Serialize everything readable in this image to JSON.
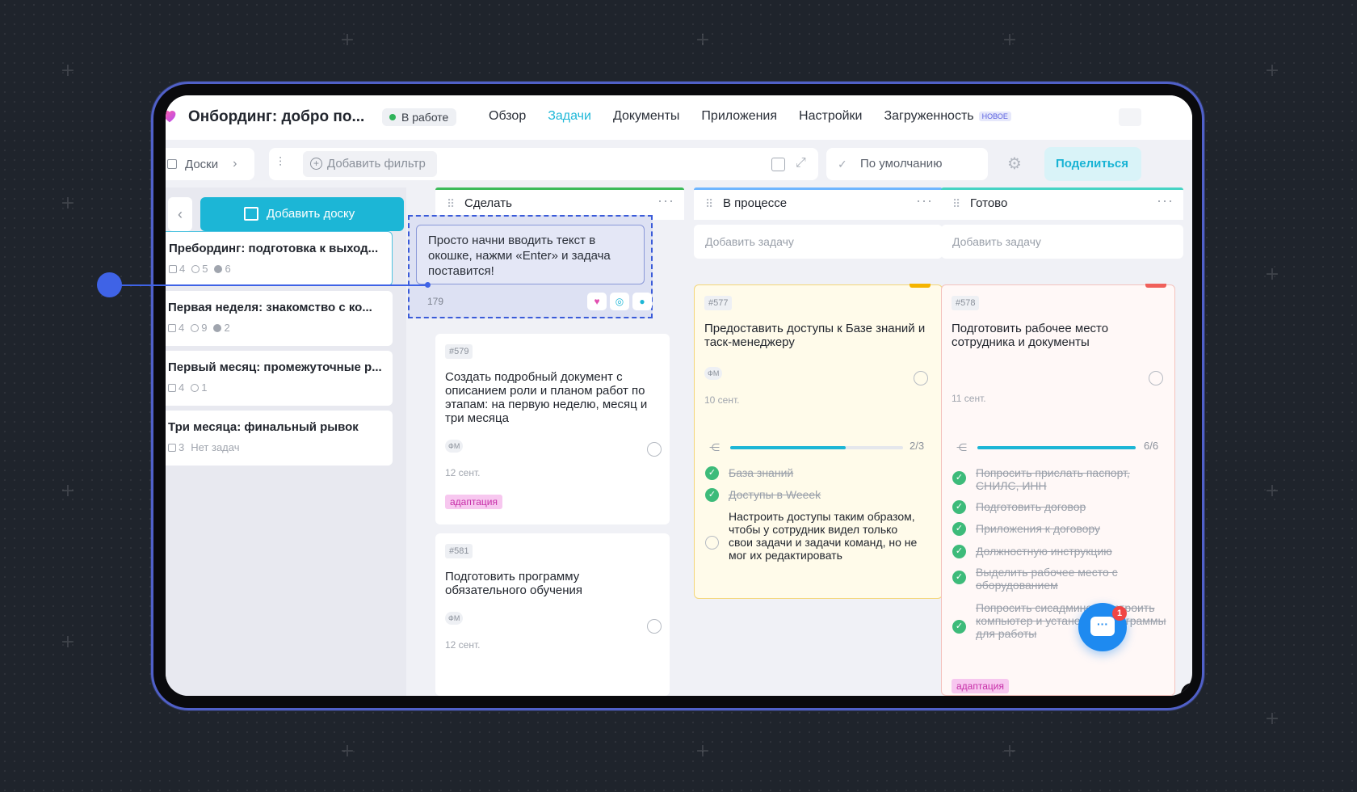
{
  "project": {
    "title": "Онбординг: добро по...",
    "status": "В работе"
  },
  "nav": {
    "tabs": [
      "Обзор",
      "Задачи",
      "Документы",
      "Приложения",
      "Настройки",
      "Загруженность"
    ],
    "active_tab": "Задачи",
    "new_badge": "НОВОЕ"
  },
  "toolbar": {
    "boards_label": "Доски",
    "add_filter": "Добавить фильтр",
    "view_label": "По умолчанию",
    "share_label": "Поделиться"
  },
  "sidebar": {
    "add_board": "Добавить доску",
    "boards": [
      {
        "title": "Пребординг: подготовка к выход...",
        "stat1": "4",
        "stat2": "5",
        "stat3": "6"
      },
      {
        "title": "Первая неделя: знакомство с ко...",
        "stat1": "4",
        "stat2": "9",
        "stat3": "2"
      },
      {
        "title": "Первый месяц: промежуточные р...",
        "stat1": "4",
        "stat2": "1"
      },
      {
        "title": "Три месяца: финальный рывок",
        "stat1": "3",
        "no_tasks": "Нет задач"
      }
    ]
  },
  "columns": {
    "todo": {
      "title": "Сделать",
      "color": "#3dbb5a"
    },
    "progress": {
      "title": "В процессе",
      "color": "#6fb6ff",
      "add_task": "Добавить задачу"
    },
    "done": {
      "title": "Готово",
      "color": "#46d4c4",
      "add_task": "Добавить задачу"
    }
  },
  "draft": {
    "text": "Просто начни вводить текст в окошке, нажми «Enter» и задача поставится!",
    "number": "179"
  },
  "tasks": {
    "t579": {
      "id": "#579",
      "title": "Создать подробный документ с описанием роли и планом работ по этапам: на первую неделю, месяц и три месяца",
      "avatar": "ФМ",
      "date": "12 сент.",
      "tag": "адаптация"
    },
    "t581": {
      "id": "#581",
      "title": "Подготовить программу обязательного обучения",
      "avatar": "ФМ",
      "date": "12 сент."
    },
    "t577": {
      "id": "#577",
      "title": "Предоставить доступы к Базе знаний и таск-менеджеру",
      "avatar": "ФМ",
      "date": "10 сент.",
      "progress_label": "2/3",
      "progress": 0.67,
      "subtasks": [
        "База знаний",
        "Доступы в Weeek",
        "Настроить доступы таким образом, чтобы у сотрудник видел только свои задачи и задачи команд, но не мог их редактировать"
      ]
    },
    "t578": {
      "id": "#578",
      "title": "Подготовить рабочее место сотрудника и документы",
      "date": "11 сент.",
      "progress_label": "6/6",
      "progress": 1.0,
      "subtasks": [
        "Попросить прислать паспорт, СНИЛС, ИНН",
        "Подготовить договор",
        "Приложения к договору",
        "Должностную инструкцию",
        "Выделить рабочее место с оборудованием",
        "Попросить сисадминов настроить компьютер и установить программы для работы"
      ],
      "tag": "адаптация"
    }
  },
  "chat": {
    "badge": "1"
  }
}
